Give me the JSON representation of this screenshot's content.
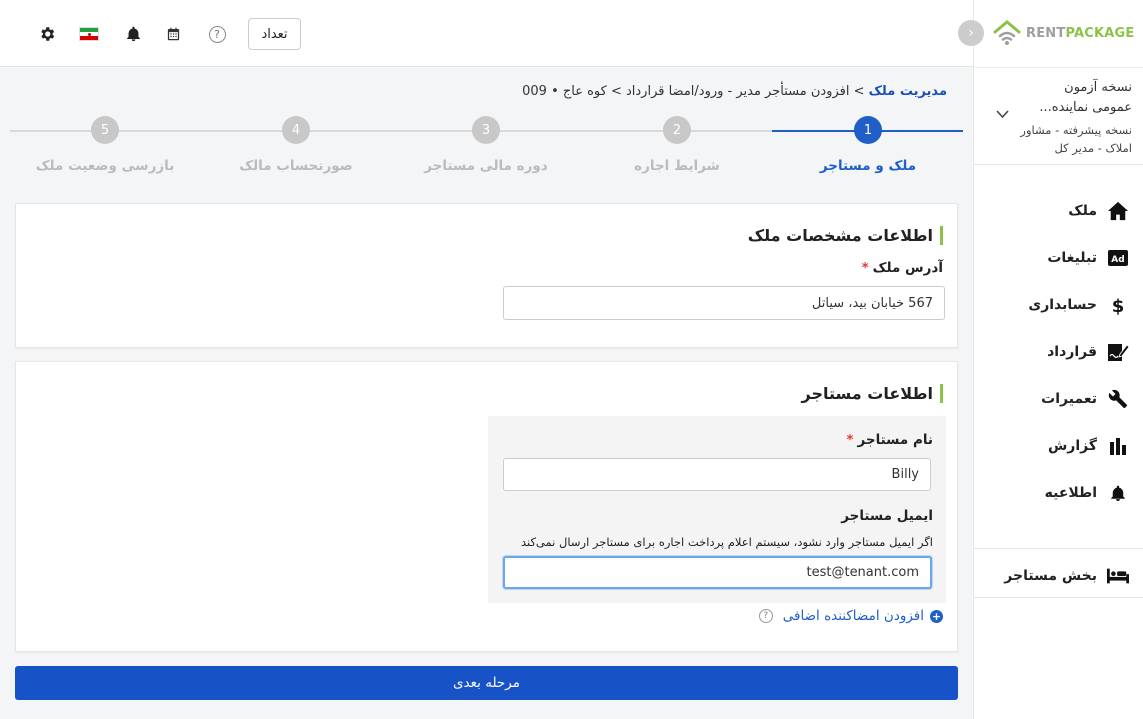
{
  "topbar": {
    "count_button": "تعداد",
    "help_label": "?",
    "icons": [
      "settings-icon",
      "iran-flag-icon",
      "bell-icon",
      "calendar-icon",
      "help-icon"
    ]
  },
  "sidebar": {
    "logo_rent": "RENT",
    "logo_package": "PACKAGE",
    "collapse_icon": "›",
    "account": {
      "line1": "نسخه آزمون",
      "line2": "عمومی نماینده...",
      "line3": "نسخه پیشرفته - مشاور املاک - مدیر کل"
    },
    "items": [
      {
        "label": "ملک",
        "icon": "home-icon"
      },
      {
        "label": "تبلیغات",
        "icon": "ad-icon"
      },
      {
        "label": "حسابداری",
        "icon": "dollar-icon"
      },
      {
        "label": "قرارداد",
        "icon": "contract-icon"
      },
      {
        "label": "تعمیرات",
        "icon": "wrench-icon"
      },
      {
        "label": "گزارش",
        "icon": "chart-icon"
      },
      {
        "label": "اطلاعیه",
        "icon": "bell-icon"
      }
    ],
    "tenant_section": {
      "label": "بخش مستاجر",
      "icon": "bed-icon"
    }
  },
  "breadcrumb": {
    "link": "مدیریت ملک",
    "rest": " > افزودن مستأجر مدیر - ورود/امضا قرارداد > کوه عاج • 009"
  },
  "steps": [
    {
      "num": "1",
      "label": "ملک و مستاجر",
      "active": true
    },
    {
      "num": "2",
      "label": "شرایط اجاره",
      "active": false
    },
    {
      "num": "3",
      "label": "دوره مالی مستاجر",
      "active": false
    },
    {
      "num": "4",
      "label": "صورتحساب مالک",
      "active": false
    },
    {
      "num": "5",
      "label": "بازرسی وضعیت ملک",
      "active": false
    }
  ],
  "property_card": {
    "title": "اطلاعات مشخصات ملک",
    "address_label": "آدرس ملک",
    "required_mark": "*",
    "address_value": "567 خیابان بید، سیاتل"
  },
  "tenant_card": {
    "title": "اطلاعات مستاجر",
    "name_label": "نام مستاجر",
    "required_mark": "*",
    "name_value": "Billy",
    "email_label": "ایمیل مستاجر",
    "email_hint": "اگر ایمیل مستاجر وارد نشود، سیستم اعلام پرداخت اجاره برای مستاجر ارسال نمی‌کند",
    "email_value": "test@tenant.com",
    "add_signer_label": "افزودن امضاکننده اضافی",
    "add_signer_plus": "+",
    "add_signer_help": "?"
  },
  "next_button": "مرحله بعدی",
  "colors": {
    "primary": "#1753c6",
    "accent_green": "#8bc34a",
    "required": "#e53935"
  }
}
